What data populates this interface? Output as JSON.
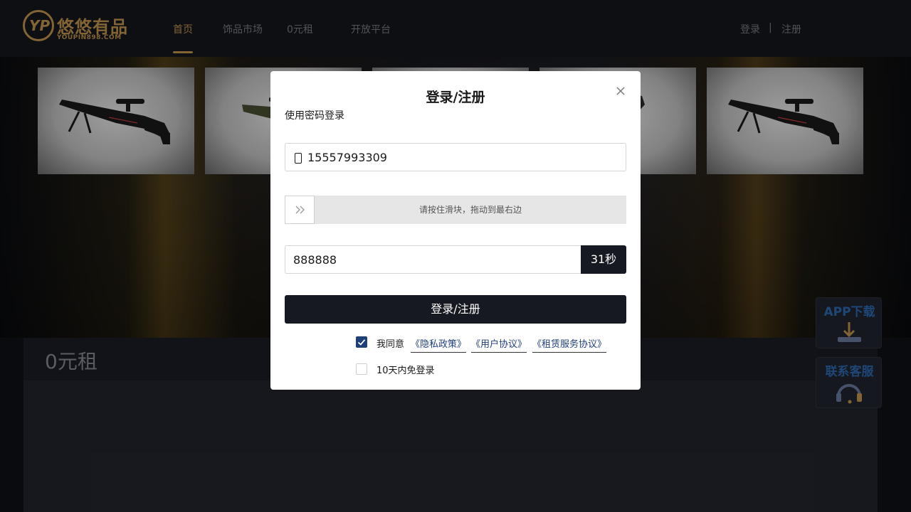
{
  "header": {
    "logo_text": "悠悠有品",
    "logo_sub": "YOUPIN898.COM",
    "logo_mark": "YP",
    "nav": [
      {
        "label": "首页",
        "active": true
      },
      {
        "label": "饰品市场",
        "active": false
      },
      {
        "label": "0元租",
        "active": false
      },
      {
        "label": "开放平台",
        "active": false
      }
    ],
    "login": "登录",
    "separator": "|",
    "register": "注册"
  },
  "section": {
    "title": "0元租"
  },
  "side": {
    "app_download": "APP下载",
    "customer_service": "联系客服"
  },
  "modal": {
    "title": "登录/注册",
    "mode_link": "使用密码登录",
    "phone_value": "15557993309",
    "slider_hint": "请按住滑块，拖动到最右边",
    "code_value": "888888",
    "code_countdown": "31秒",
    "submit_label": "登录/注册",
    "agree_prefix": "我同意",
    "privacy_link": "《隐私政策》",
    "user_link": "《用户协议》",
    "lease_link": "《租赁服务协议》",
    "agree_checked": true,
    "remember_label": "10天内免登录",
    "remember_checked": false
  },
  "colors": {
    "accent": "#c89a52",
    "dark_button": "#161922",
    "link_blue": "#1f3f7a",
    "side_blue": "#2f6eb8"
  }
}
